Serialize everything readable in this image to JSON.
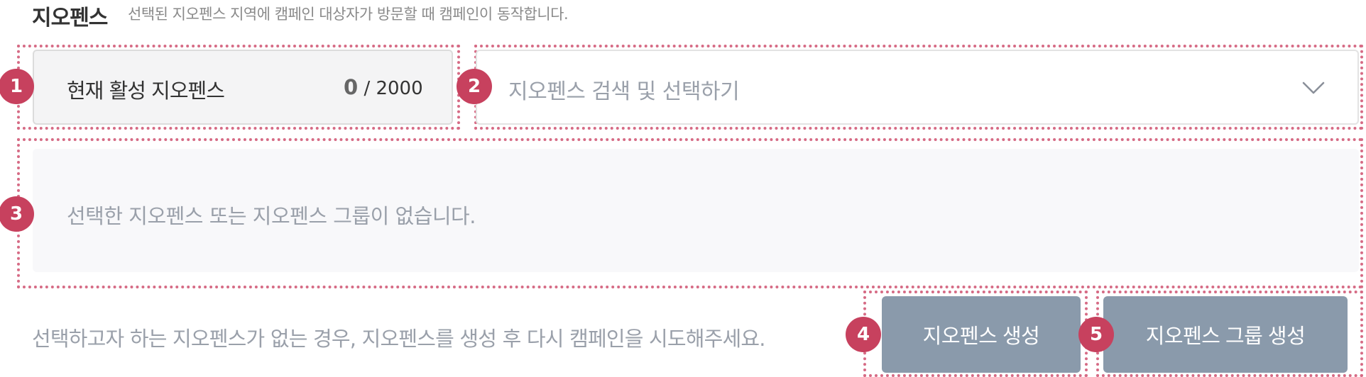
{
  "header": {
    "title": "지오펜스",
    "description": "선택된 지오펜스 지역에 캠페인 대상자가 방문할 때 캠페인이 동작합니다."
  },
  "active_geofences": {
    "label": "현재 활성 지오펜스",
    "count": "0",
    "separator": "/ 2000"
  },
  "geofence_select": {
    "placeholder": "지오펜스 검색 및 선택하기",
    "icon": "chevron-down-icon"
  },
  "selected_list": {
    "empty_text": "선택한 지오펜스 또는 지오펜스 그룹이 없습니다."
  },
  "footer": {
    "hint": "선택하고자 하는 지오펜스가 없는 경우, 지오펜스를 생성 후 다시 캠페인을 시도해주세요.",
    "create_button": "지오펜스 생성",
    "create_group_button": "지오펜스 그룹 생성"
  },
  "annotations": {
    "badges": [
      "1",
      "2",
      "3",
      "4",
      "5"
    ]
  },
  "colors": {
    "badge": "#c7415e",
    "dotted_outline": "#d66b85",
    "button_bg": "#8a9aab",
    "placeholder_text": "#9aa0aa"
  }
}
